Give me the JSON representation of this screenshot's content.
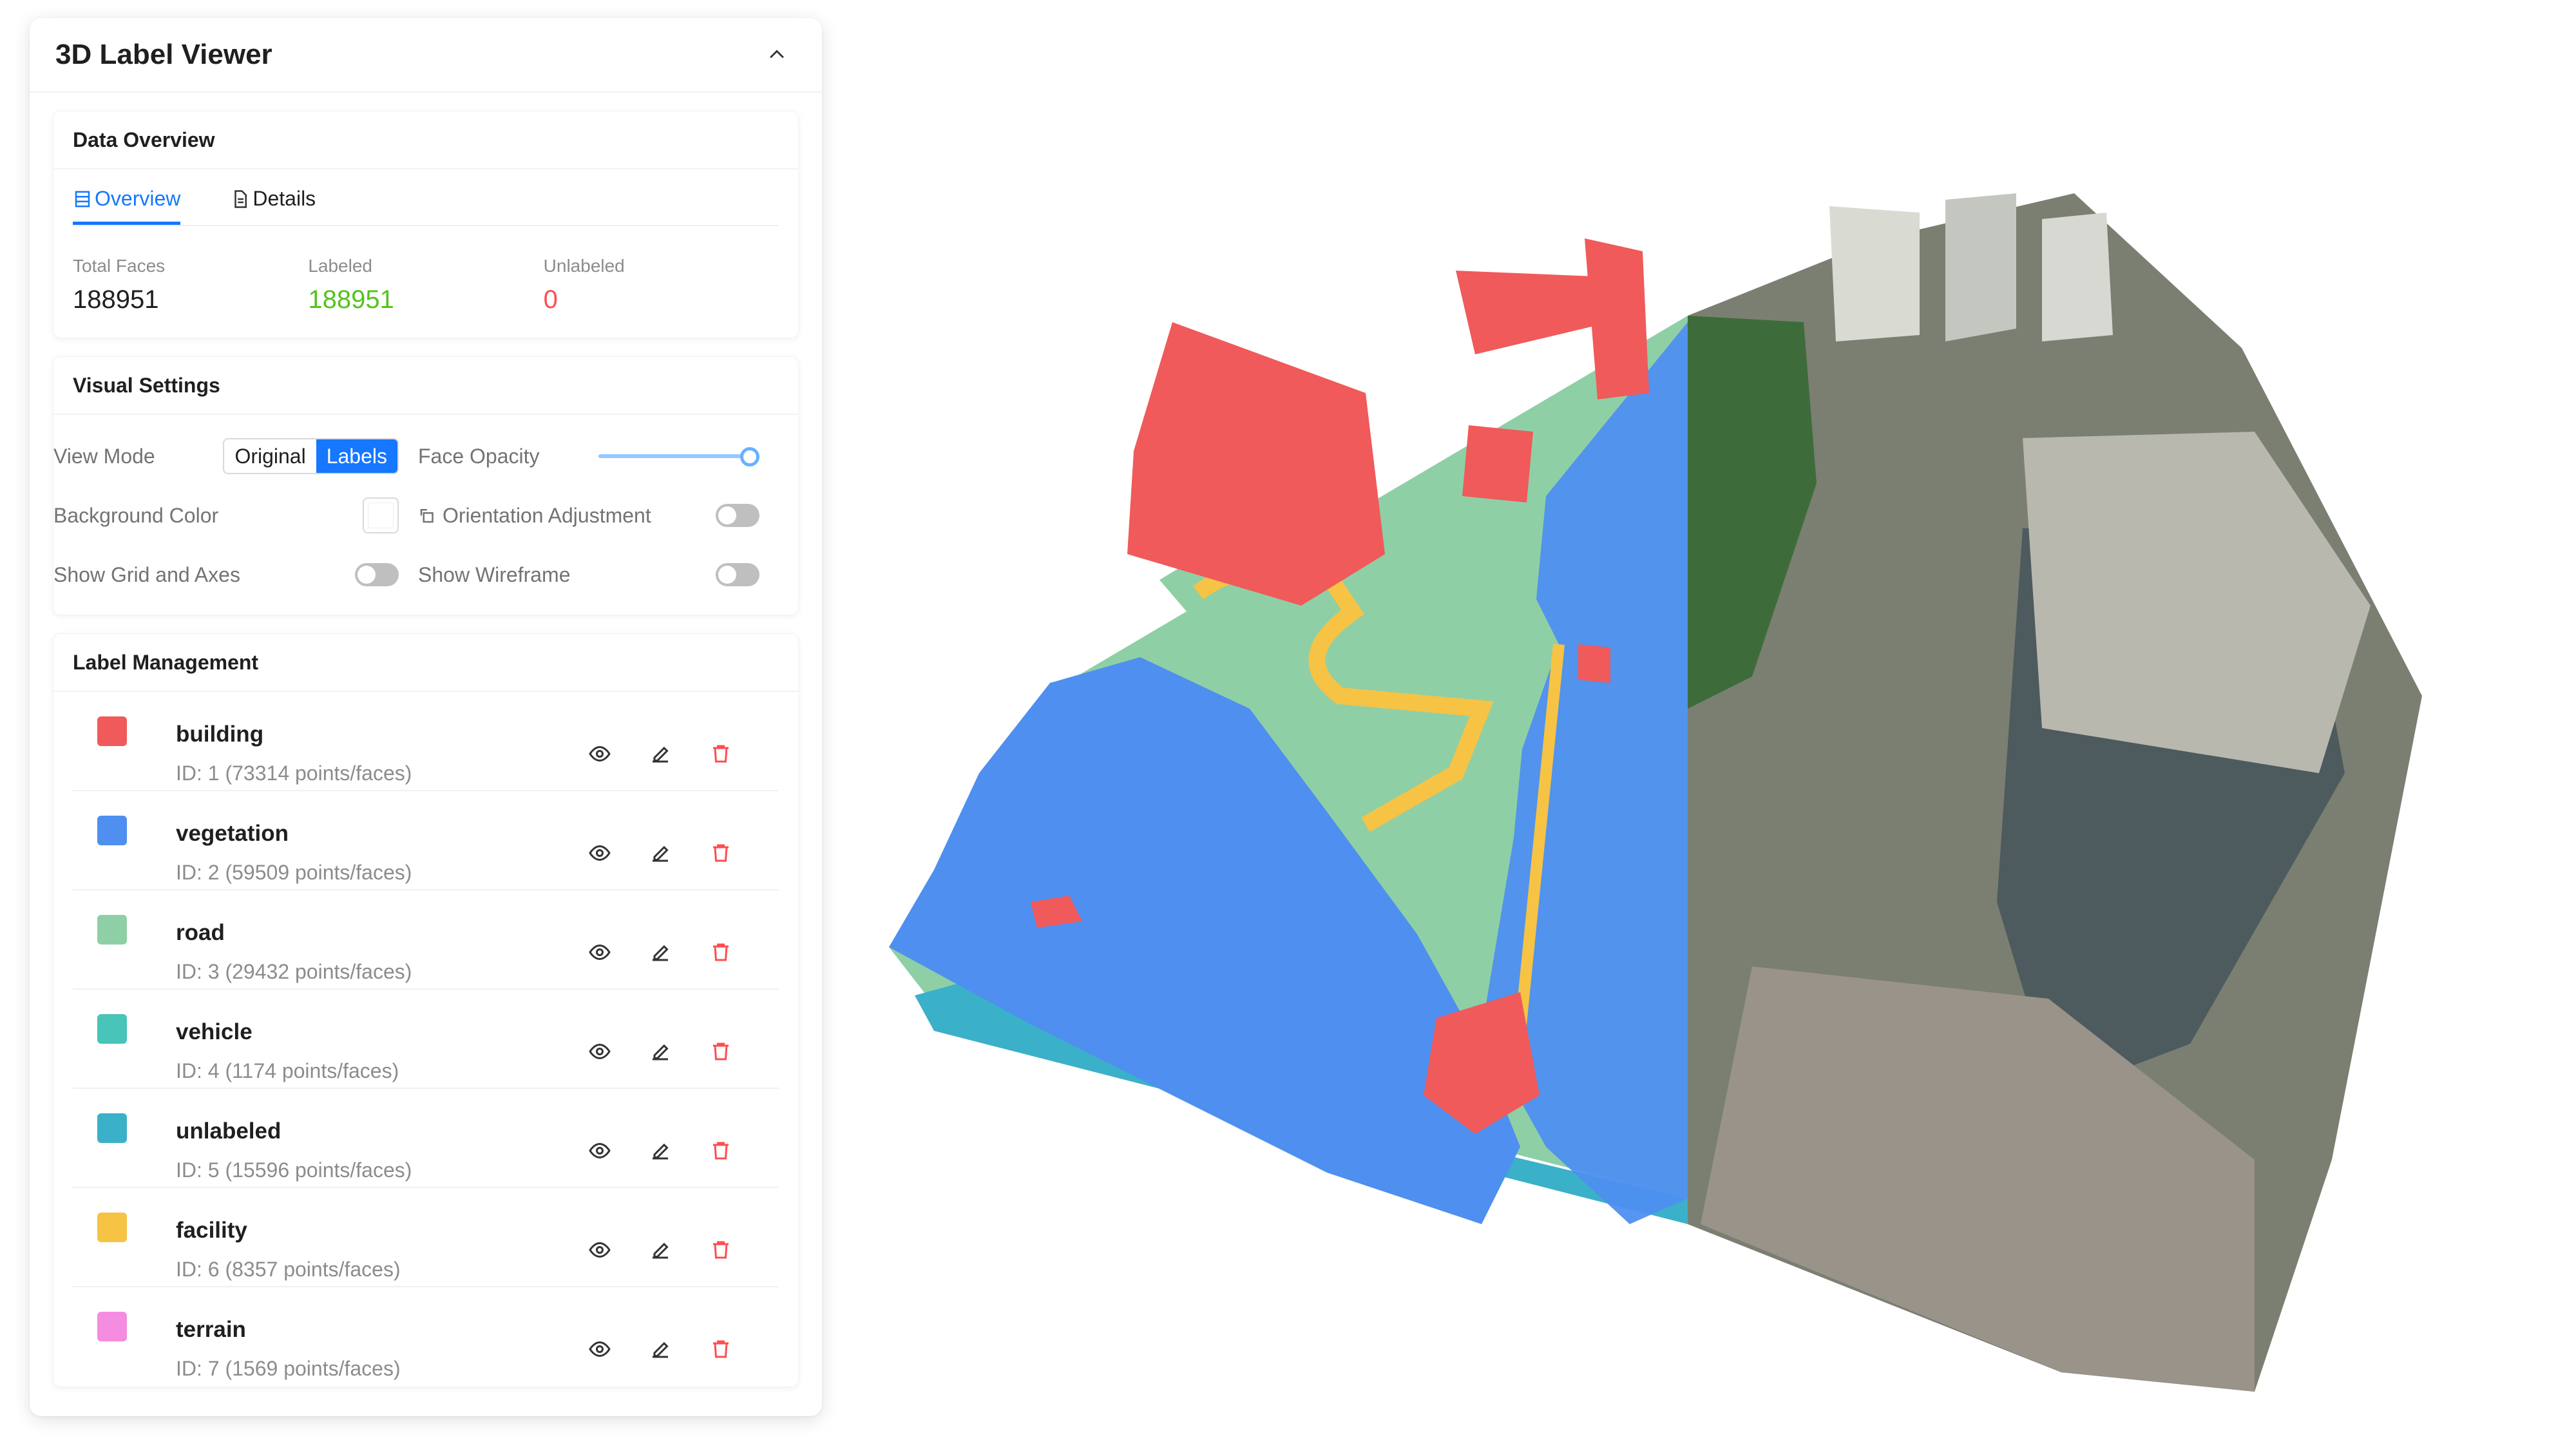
{
  "panel": {
    "title": "3D Label Viewer"
  },
  "data_overview": {
    "title": "Data Overview",
    "tabs": [
      {
        "label": "Overview",
        "active": true
      },
      {
        "label": "Details",
        "active": false
      }
    ],
    "stats": [
      {
        "label": "Total Faces",
        "value": "188951"
      },
      {
        "label": "Labeled",
        "value": "188951"
      },
      {
        "label": "Unlabeled",
        "value": "0"
      }
    ]
  },
  "visual_settings": {
    "title": "Visual Settings",
    "view_mode_label": "View Mode",
    "view_mode_options": [
      "Original",
      "Labels"
    ],
    "view_mode_selected": "Labels",
    "face_opacity_label": "Face Opacity",
    "face_opacity_value": 1.0,
    "background_color_label": "Background Color",
    "background_color": "#ffffff",
    "orientation_label": "Orientation Adjustment",
    "orientation_on": false,
    "grid_label": "Show Grid and Axes",
    "grid_on": false,
    "wireframe_label": "Show Wireframe",
    "wireframe_on": false
  },
  "label_management": {
    "title": "Label Management",
    "labels": [
      {
        "name": "building",
        "id_text": "ID: 1 (73314 points/faces)",
        "color": "#f05a5a"
      },
      {
        "name": "vegetation",
        "id_text": "ID: 2 (59509 points/faces)",
        "color": "#4e8ff0"
      },
      {
        "name": "road",
        "id_text": "ID: 3 (29432 points/faces)",
        "color": "#8fcfa6"
      },
      {
        "name": "vehicle",
        "id_text": "ID: 4 (1174 points/faces)",
        "color": "#48c4b8"
      },
      {
        "name": "unlabeled",
        "id_text": "ID: 5 (15596 points/faces)",
        "color": "#3bb0c9"
      },
      {
        "name": "facility",
        "id_text": "ID: 6 (8357 points/faces)",
        "color": "#f6c344"
      },
      {
        "name": "terrain",
        "id_text": "ID: 7 (1569 points/faces)",
        "color": "#f48ce0"
      }
    ]
  }
}
